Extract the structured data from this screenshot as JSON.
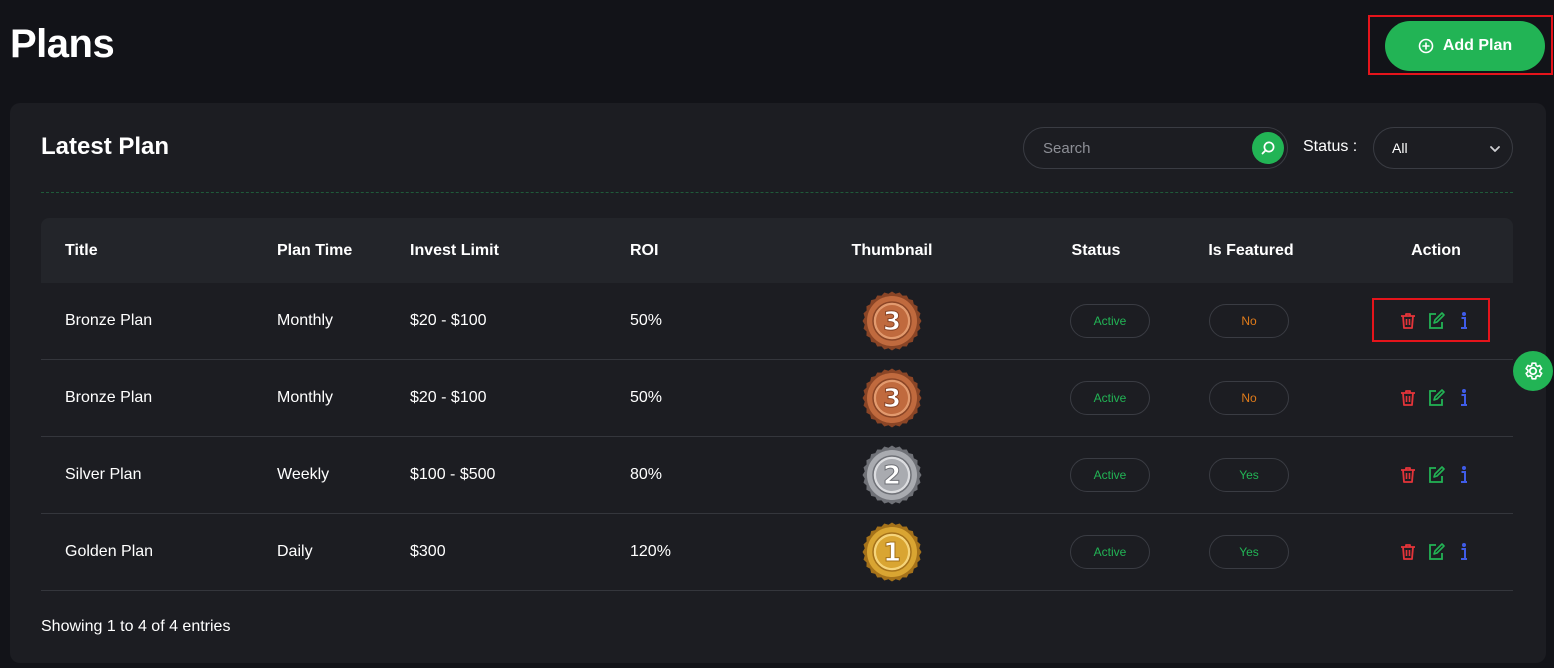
{
  "page": {
    "title": "Plans"
  },
  "header": {
    "add_button_label": "Add Plan",
    "add_icon": "plus-circle-icon"
  },
  "card": {
    "title": "Latest Plan",
    "search": {
      "placeholder": "Search",
      "value": "",
      "icon": "search-icon"
    },
    "status_filter": {
      "label": "Status :",
      "selected": "All",
      "icon": "chevron-down-icon"
    }
  },
  "table": {
    "columns": [
      "Title",
      "Plan Time",
      "Invest Limit",
      "ROI",
      "Thumbnail",
      "Status",
      "Is Featured",
      "Action"
    ],
    "rows": [
      {
        "title": "Bronze Plan",
        "plan_time": "Monthly",
        "invest_limit": "$20 - $100",
        "roi": "50%",
        "thumbnail": {
          "medal": "bronze",
          "rank": "3"
        },
        "status": "Active",
        "featured": "No"
      },
      {
        "title": "Bronze Plan",
        "plan_time": "Monthly",
        "invest_limit": "$20 - $100",
        "roi": "50%",
        "thumbnail": {
          "medal": "bronze",
          "rank": "3"
        },
        "status": "Active",
        "featured": "No"
      },
      {
        "title": "Silver Plan",
        "plan_time": "Weekly",
        "invest_limit": "$100 - $500",
        "roi": "80%",
        "thumbnail": {
          "medal": "silver",
          "rank": "2"
        },
        "status": "Active",
        "featured": "Yes"
      },
      {
        "title": "Golden Plan",
        "plan_time": "Daily",
        "invest_limit": "$300",
        "roi": "120%",
        "thumbnail": {
          "medal": "gold",
          "rank": "1"
        },
        "status": "Active",
        "featured": "Yes"
      }
    ],
    "action_icons": [
      "trash-icon",
      "edit-icon",
      "info-icon"
    ]
  },
  "footer": {
    "entries_text": "Showing 1 to 4 of 4 entries"
  },
  "settings": {
    "icon": "gear-icon"
  },
  "colors": {
    "accent": "#22b455",
    "active_text": "#22b455",
    "no_text": "#e07b1a",
    "yes_text": "#22b455",
    "delete": "#e5343a",
    "edit": "#22b455",
    "info": "#3f5ce8",
    "highlight": "#e5141b",
    "medal_bronze": "#c06a3e",
    "medal_silver": "#a9abb0",
    "medal_gold": "#d9a532"
  }
}
